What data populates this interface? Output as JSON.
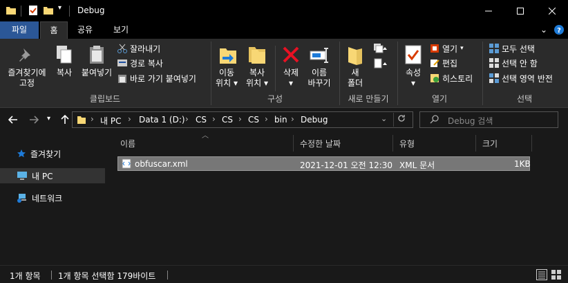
{
  "window": {
    "title": "Debug"
  },
  "tabs": [
    {
      "label": "파일"
    },
    {
      "label": "홈"
    },
    {
      "label": "공유"
    },
    {
      "label": "보기"
    }
  ],
  "ribbon": {
    "clipboard": {
      "pin_label_1": "즐겨찾기에",
      "pin_label_2": "고정",
      "copy": "복사",
      "paste": "붙여넣기",
      "cut": "잘라내기",
      "copy_path": "경로 복사",
      "paste_shortcut": "바로 가기 붙여넣기",
      "group": "클립보드"
    },
    "organize": {
      "move_1": "이동",
      "move_2": "위치",
      "copy_1": "복사",
      "copy_2": "위치",
      "delete": "삭제",
      "rename_1": "이름",
      "rename_2": "바꾸기",
      "group": "구성"
    },
    "new": {
      "folder_1": "새",
      "folder_2": "폴더",
      "group": "새로 만들기"
    },
    "open": {
      "properties": "속성",
      "open": "열기",
      "edit": "편집",
      "history": "히스토리",
      "group": "열기"
    },
    "select": {
      "all": "모두 선택",
      "none": "선택 안 함",
      "invert": "선택 영역 반전",
      "group": "선택"
    }
  },
  "address": {
    "crumbs": [
      "내 PC",
      "Data 1 (D:)",
      "CS",
      "CS",
      "CS",
      "bin",
      "Debug"
    ],
    "search_placeholder": "Debug 검색"
  },
  "nav_pane": {
    "items": [
      {
        "label": "즐겨찾기"
      },
      {
        "label": "내 PC"
      },
      {
        "label": "네트워크"
      }
    ]
  },
  "columns": {
    "name": "이름",
    "modified": "수정한 날짜",
    "type": "유형",
    "size": "크기"
  },
  "files": [
    {
      "name": "obfuscar.xml",
      "modified": "2021-12-01 오전 12:30",
      "type": "XML 문서",
      "size": "1KB"
    }
  ],
  "status": {
    "count": "1개 항목",
    "selected": "1개 항목 선택함 179바이트"
  },
  "colors": {
    "accent": "#2b5797",
    "background": "#191919",
    "ribbon": "#2b2b2b",
    "selection": "#777777"
  }
}
